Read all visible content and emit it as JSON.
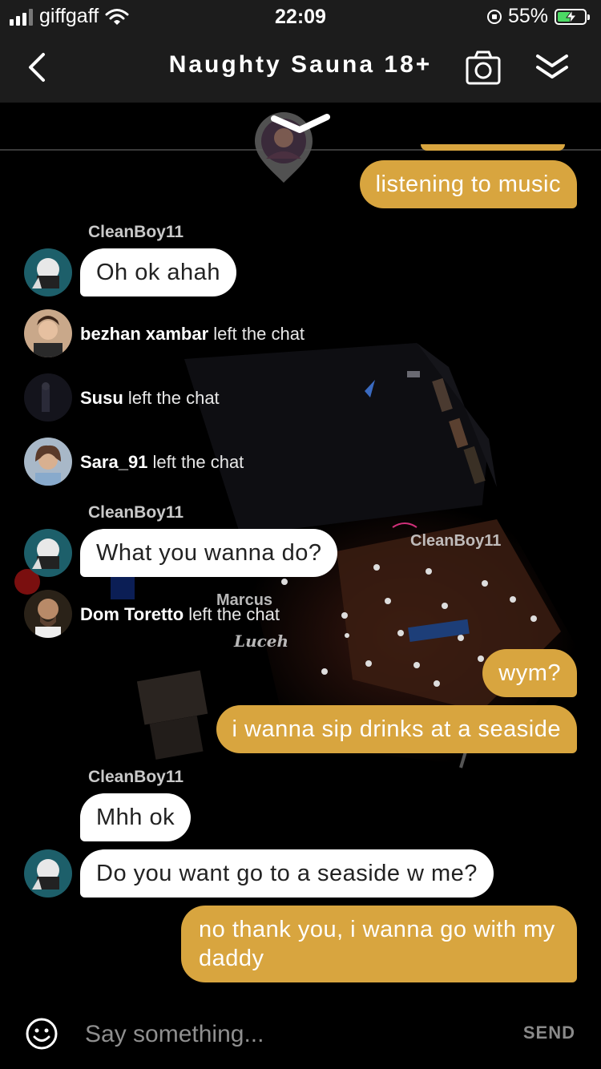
{
  "status_bar": {
    "carrier": "giffgaff",
    "time": "22:09",
    "battery_text": "55%",
    "battery_level": 0.55,
    "icons": [
      "signal-icon",
      "wifi-icon",
      "orientation-lock-icon",
      "battery-charging-icon"
    ]
  },
  "header": {
    "title": "Naughty Sauna 18+",
    "icons": [
      "back-chevron-icon",
      "camera-icon",
      "collapse-chevrons-icon"
    ]
  },
  "scene_labels": {
    "user1": "CleanBoy11",
    "user2": "Marcus",
    "user3": "Luceh"
  },
  "messages": [
    {
      "type": "outgoing",
      "text": "listening to music"
    },
    {
      "type": "incoming",
      "sender": "CleanBoy11",
      "text": "Oh ok ahah"
    },
    {
      "type": "system",
      "user": "bezhan xambar",
      "text": "left the chat"
    },
    {
      "type": "system",
      "user": "Susu",
      "text": "left the chat"
    },
    {
      "type": "system",
      "user": "Sara_91",
      "text": "left the chat"
    },
    {
      "type": "incoming",
      "sender": "CleanBoy11",
      "text": "What you wanna do?"
    },
    {
      "type": "system",
      "user": "Dom Toretto",
      "text": "left the chat"
    },
    {
      "type": "outgoing",
      "text": "wym?"
    },
    {
      "type": "outgoing",
      "text": "i wanna sip drinks at a seaside"
    },
    {
      "type": "incoming",
      "sender": "CleanBoy11",
      "text": "Mhh ok"
    },
    {
      "type": "incoming",
      "text": "Do you want go to a seaside w me?"
    },
    {
      "type": "outgoing",
      "text": "no thank you, i wanna go with my daddy"
    }
  ],
  "input": {
    "placeholder": "Say something...",
    "send_label": "SEND"
  },
  "colors": {
    "outgoing_bubble": "#d8a53f",
    "incoming_bubble": "#ffffff",
    "header_bg": "#1c1c1c",
    "chat_bg": "#000000"
  }
}
